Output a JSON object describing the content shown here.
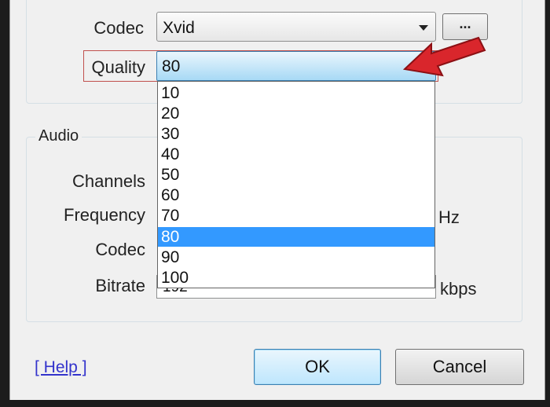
{
  "video": {
    "codec_label": "Codec",
    "codec_value": "Xvid",
    "codec_settings_button": "...",
    "quality_label": "Quality",
    "quality_value": "80",
    "quality_options": [
      "10",
      "20",
      "30",
      "40",
      "50",
      "60",
      "70",
      "80",
      "90",
      "100"
    ],
    "quality_selected": "80"
  },
  "audio": {
    "group_title": "Audio",
    "channels_label": "Channels",
    "frequency_label": "Frequency",
    "frequency_unit": "Hz",
    "codec_label": "Codec",
    "bitrate_label": "Bitrate",
    "bitrate_value": "192",
    "bitrate_unit": "kbps"
  },
  "footer": {
    "help_link": "[ Help ]",
    "ok_button": "OK",
    "cancel_button": "Cancel"
  },
  "colors": {
    "highlight": "#3399ff",
    "annotation_arrow": "#d9262c",
    "quality_outline": "#c0504d"
  },
  "icons": {
    "combo_arrow": "chevron-down-icon",
    "annotation": "red-arrow-icon"
  }
}
